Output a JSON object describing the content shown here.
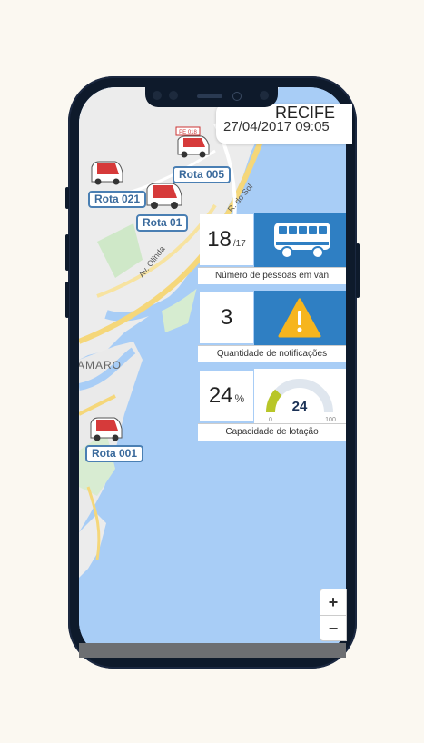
{
  "header": {
    "city": "RECIFE",
    "datetime": "27/04/2017 09:05"
  },
  "map": {
    "labels": {
      "neighborhood": "AMARO",
      "street_olinda": "Av. Olinda",
      "street_sol": "R. do Sol"
    },
    "routes": [
      {
        "label": "Rota 005"
      },
      {
        "label": "Rota 021"
      },
      {
        "label": "Rota 01"
      },
      {
        "label": "Rota 001"
      }
    ],
    "van_plate": "PE 018",
    "zoom_in": "+",
    "zoom_out": "−"
  },
  "stats": {
    "people": {
      "value": "18",
      "total": "/17",
      "caption": "Número de pessoas em van",
      "icon": "bus-icon"
    },
    "notifications": {
      "value": "3",
      "caption": "Quantidade de notificações",
      "icon": "warning-icon"
    },
    "capacity": {
      "value": "24",
      "unit": "%",
      "caption": "Capacidade de lotação",
      "icon": "gauge-icon",
      "gauge_value": "24",
      "gauge_min": "0",
      "gauge_max": "100",
      "gauge_fraction": 0.24
    }
  },
  "colors": {
    "water": "#a8cdf6",
    "land": "#eeeeee",
    "panel_blue": "#2f7fc3",
    "route_border": "#4a7fb3"
  }
}
